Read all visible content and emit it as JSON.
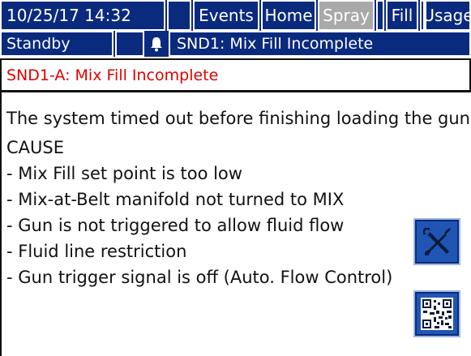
{
  "header": {
    "datetime": "10/25/17 14:32",
    "tabs": [
      {
        "label": "Events",
        "active": false
      },
      {
        "label": "Home",
        "active": false
      },
      {
        "label": "Spray",
        "active": true
      },
      {
        "label": "Fill",
        "active": false
      },
      {
        "label": "Usage",
        "active": false
      }
    ]
  },
  "status": {
    "mode": "Standby",
    "alarm_icon": "bell-icon",
    "alarm_text": "SND1: Mix Fill Incomplete"
  },
  "alarm": {
    "title": "SND1-A: Mix Fill Incomplete",
    "title_color": "#e00000",
    "lines": [
      "The system timed out before finishing loading the gun",
      "CAUSE",
      "- Mix Fill set point is too low",
      "- Mix-at-Belt manifold not turned to MIX",
      "- Gun is not triggered to allow fluid flow",
      "- Fluid line restriction",
      "- Gun trigger signal is off (Auto. Flow Control)"
    ]
  },
  "buttons": {
    "tools_icon": "wrench-screwdriver-icon",
    "qr_icon": "qr-code-icon"
  },
  "colors": {
    "header_bg": "#0a2a7e",
    "active_tab": "#a9a9a9",
    "button_bg": "#1f56b4"
  }
}
